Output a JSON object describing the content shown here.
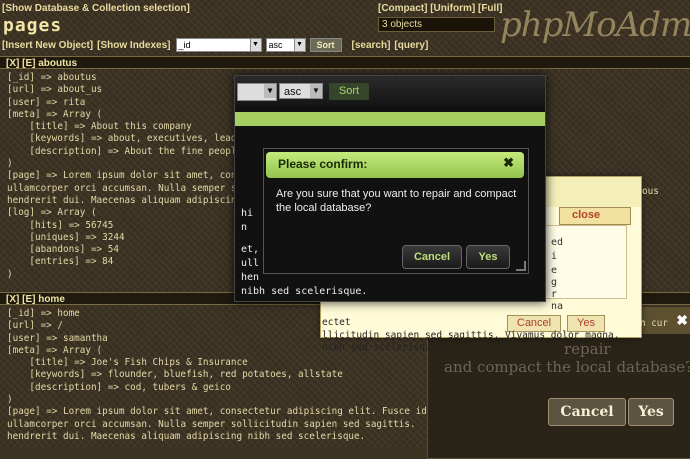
{
  "top": {
    "show_db": "[Show Database & Collection selection]",
    "title": "pages",
    "insert": "[Insert New Object]",
    "show_indexes": "[Show Indexes]",
    "sort_field": "_id",
    "sort_dir": "asc",
    "sort_button": "Sort",
    "search": "[search]",
    "query": "[query]",
    "modes": "[Compact] [Uniform] [Full]",
    "object_count": "3 objects",
    "logo": "phpMoAdmin"
  },
  "sections": [
    {
      "header": "[X] [E] aboutus",
      "lines": [
        "[_id] => aboutus",
        "[url] => about_us",
        "[user] => rita",
        "[meta] => Array (",
        "    [title] => About this company",
        "    [keywords] => about, executives, leadership",
        "    [description] => About the fine people here",
        ")",
        "[page] => Lorem ipsum dolor sit amet, consectetur",
        "ullamcorper orci accumsan. Nulla semper sollicit",
        "hendrerit dui. Maecenas aliquam adipiscing nibh",
        "[log] => Array (",
        "    [hits] => 56745",
        "    [uniques] => 3244",
        "    [abandons] => 54",
        "    [entries] => 84",
        ")"
      ]
    },
    {
      "header": "[X] [E] home",
      "lines": [
        "[_id] => home",
        "[url] => /",
        "[user] => samantha",
        "[meta] => Array (",
        "    [title] => Joe's Fish Chips & Insurance",
        "    [keywords] => flounder, bluefish, red potatoes, allstate",
        "    [description] => cod, tubers & geico",
        ")",
        "[page] => Lorem ipsum dolor sit amet, consectetur adipiscing elit. Fusce id te",
        "ullamcorper orci accumsan. Nulla semper sollicitudin sapien sed sagittis.",
        "hendrerit dui. Maecenas aliquam adipiscing nibh sed scelerisque."
      ]
    }
  ],
  "dialog_front": {
    "sort_dir": "asc",
    "sort_button": "Sort",
    "bg_lines": [
      "hi",
      "n",
      "et,",
      "ull",
      "hen",
      "nibh sed scelerisque."
    ],
    "confirm_title": "Please confirm:",
    "confirm_close": "✖",
    "confirm_message": "Are you sure that you want to repair and compact the local database?",
    "cancel": "Cancel",
    "yes": "Yes"
  },
  "dialog_middle": {
    "close": "close",
    "lines": [
      "ed",
      "i",
      "e",
      "g",
      "r",
      "na"
    ],
    "cancel": "Cancel",
    "yes": "Yes",
    "code_lines": [
      "ectet",
      "llicitudin sapien sed sagittis. Vivamus dolor magna,",
      "nibh sed scelerisque."
    ],
    "frag1": "ous",
    "frag2": "n cur"
  },
  "dialog_back": {
    "close": "✖",
    "message_line1": "repair",
    "message_line2": "and compact the local database?",
    "cancel": "Cancel",
    "yes": "Yes"
  }
}
